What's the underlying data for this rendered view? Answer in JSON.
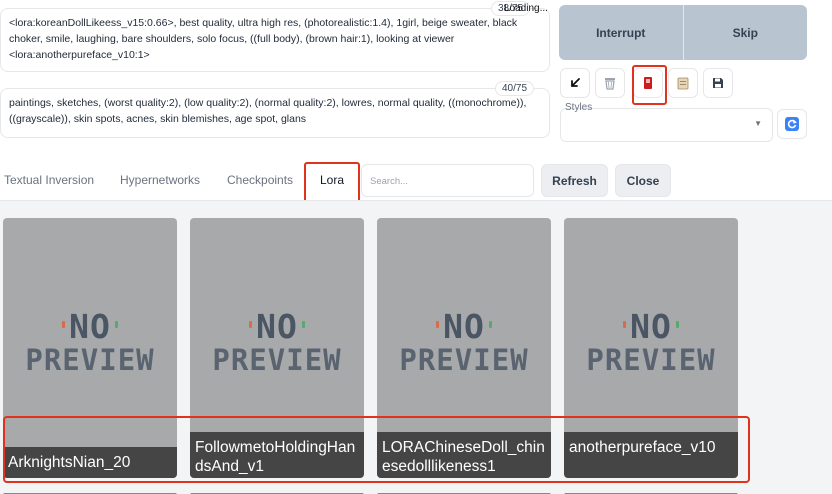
{
  "prompts": {
    "positive": "<lora:koreanDollLikeess_v15:0.66>, best quality, ultra high res, (photorealistic:1.4), 1girl, beige sweater, black choker, smile, laughing, bare shoulders, solo focus, ((full body), (brown hair:1), looking at viewer <lora:anotherpureface_v10:1>",
    "positive_counter": "38/75",
    "positive_counter_overlay": "Loading...",
    "negative": "paintings, sketches, (worst quality:2), (low quality:2), (normal quality:2), lowres, normal quality, ((monochrome)), ((grayscale)), skin spots, acnes, skin blemishes, age spot, glans",
    "negative_counter": "40/75"
  },
  "generate": {
    "interrupt_label": "Interrupt",
    "skip_label": "Skip"
  },
  "toolbar": {
    "icons": [
      "paste-arrow-icon",
      "trash-icon",
      "red-card-icon",
      "clipboard-icon",
      "save-icon"
    ]
  },
  "styles": {
    "label": "Styles",
    "selected": ""
  },
  "extra_networks": {
    "tabs": [
      {
        "label": "Textual Inversion",
        "active": false
      },
      {
        "label": "Hypernetworks",
        "active": false
      },
      {
        "label": "Checkpoints",
        "active": false
      },
      {
        "label": "Lora",
        "active": true
      }
    ],
    "search_placeholder": "Search...",
    "refresh_label": "Refresh",
    "close_label": "Close"
  },
  "cards": [
    {
      "name": "ArknightsNian_20",
      "preview_line1": "NO",
      "preview_line2": "PREVIEW"
    },
    {
      "name": "FollowmetoHoldingHandsAnd_v1",
      "preview_line1": "NO",
      "preview_line2": "PREVIEW"
    },
    {
      "name": "LORAChineseDoll_chinesedolllikeness1",
      "preview_line1": "NO",
      "preview_line2": "PREVIEW"
    },
    {
      "name": "anotherpureface_v10",
      "preview_line1": "NO",
      "preview_line2": "PREVIEW"
    }
  ],
  "colors": {
    "highlight": "#e0321c",
    "card_bg": "#a8a9ab",
    "caption_bg": "#454545",
    "gen_buttons_bg": "#b8c4d0"
  }
}
